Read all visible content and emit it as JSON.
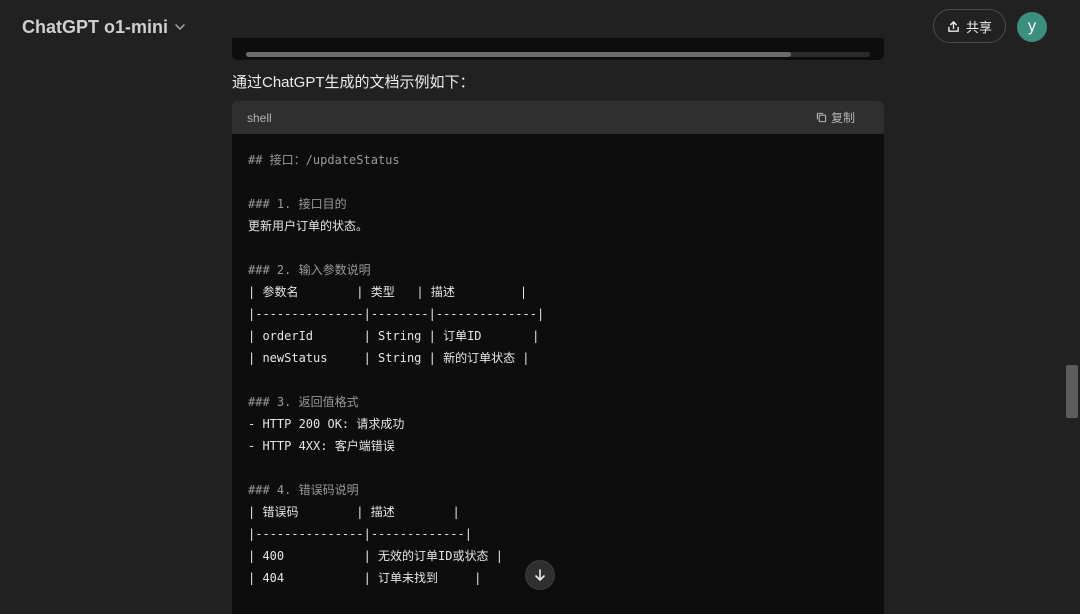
{
  "header": {
    "model_name": "ChatGPT o1-mini",
    "share_label": "共享",
    "avatar_initial": "y"
  },
  "message": {
    "intro": "通过ChatGPT生成的文档示例如下：",
    "code": {
      "language": "shell",
      "copy_label": "复制",
      "lines": [
        {
          "text": "## 接口：/updateStatus",
          "kind": "comment"
        },
        {
          "text": "",
          "kind": "text"
        },
        {
          "text": "### 1. 接口目的",
          "kind": "comment"
        },
        {
          "text": "更新用户订单的状态。",
          "kind": "text"
        },
        {
          "text": "",
          "kind": "text"
        },
        {
          "text": "### 2. 输入参数说明",
          "kind": "comment"
        },
        {
          "text": "| 参数名        | 类型   | 描述         |",
          "kind": "text"
        },
        {
          "text": "|---------------|--------|--------------|",
          "kind": "text"
        },
        {
          "text": "| orderId       | String | 订单ID       |",
          "kind": "text"
        },
        {
          "text": "| newStatus     | String | 新的订单状态 |",
          "kind": "text"
        },
        {
          "text": "",
          "kind": "text"
        },
        {
          "text": "### 3. 返回值格式",
          "kind": "comment"
        },
        {
          "text": "- HTTP 200 OK: 请求成功",
          "kind": "text"
        },
        {
          "text": "- HTTP 4XX: 客户端错误",
          "kind": "text"
        },
        {
          "text": "",
          "kind": "text"
        },
        {
          "text": "### 4. 错误码说明",
          "kind": "comment"
        },
        {
          "text": "| 错误码        | 描述        |",
          "kind": "text"
        },
        {
          "text": "|---------------|-------------|",
          "kind": "text"
        },
        {
          "text": "| 400           | 无效的订单ID或状态 |",
          "kind": "text"
        },
        {
          "text": "| 404           | 订单未找到     |",
          "kind": "text"
        }
      ]
    }
  },
  "icons": {
    "model_chevron": "chevron-down-icon",
    "share": "share-upload-icon",
    "copy": "copy-icon",
    "scroll_down": "arrow-down-icon"
  },
  "colors": {
    "background": "#212121",
    "code_background": "#0d0d0d",
    "code_header": "#2f2f2f",
    "avatar": "#3c8f7e"
  }
}
